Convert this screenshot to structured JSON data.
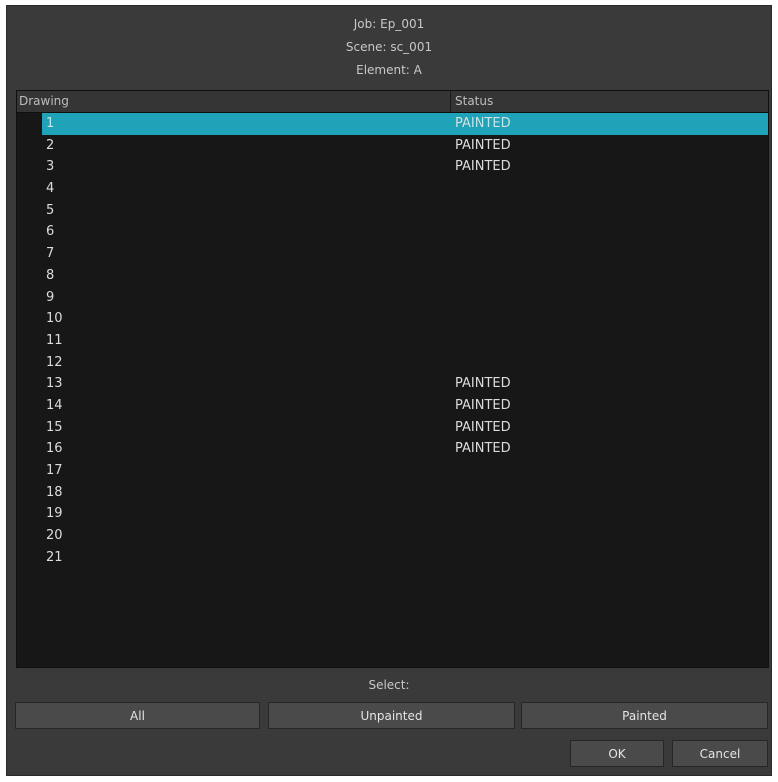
{
  "header": {
    "job": "Job: Ep_001",
    "scene": "Scene: sc_001",
    "element": "Element: A"
  },
  "table": {
    "columns": [
      "Drawing",
      "Status"
    ],
    "selected_row": 0,
    "rows": [
      {
        "drawing": "1",
        "status": "PAINTED"
      },
      {
        "drawing": "2",
        "status": "PAINTED"
      },
      {
        "drawing": "3",
        "status": "PAINTED"
      },
      {
        "drawing": "4",
        "status": ""
      },
      {
        "drawing": "5",
        "status": ""
      },
      {
        "drawing": "6",
        "status": ""
      },
      {
        "drawing": "7",
        "status": ""
      },
      {
        "drawing": "8",
        "status": ""
      },
      {
        "drawing": "9",
        "status": ""
      },
      {
        "drawing": "10",
        "status": ""
      },
      {
        "drawing": "11",
        "status": ""
      },
      {
        "drawing": "12",
        "status": ""
      },
      {
        "drawing": "13",
        "status": "PAINTED"
      },
      {
        "drawing": "14",
        "status": "PAINTED"
      },
      {
        "drawing": "15",
        "status": "PAINTED"
      },
      {
        "drawing": "16",
        "status": "PAINTED"
      },
      {
        "drawing": "17",
        "status": ""
      },
      {
        "drawing": "18",
        "status": ""
      },
      {
        "drawing": "19",
        "status": ""
      },
      {
        "drawing": "20",
        "status": ""
      },
      {
        "drawing": "21",
        "status": ""
      }
    ]
  },
  "select": {
    "label": "Select:",
    "all": "All",
    "unpainted": "Unpainted",
    "painted": "Painted"
  },
  "actions": {
    "ok": "OK",
    "cancel": "Cancel"
  },
  "colors": {
    "selection": "#1fa3b8",
    "dialog_bg": "#3a3a3a",
    "table_bg": "#171717"
  }
}
